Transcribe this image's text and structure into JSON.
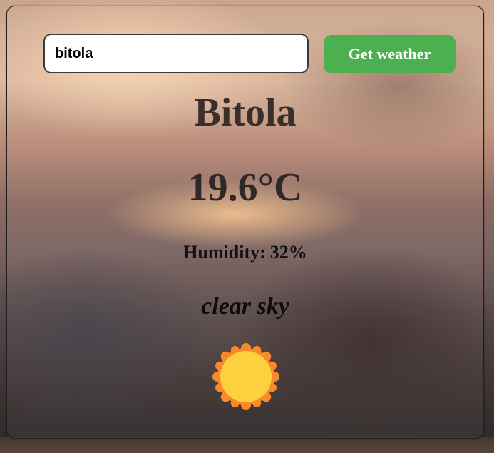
{
  "search": {
    "value": "bitola",
    "button_label": "Get weather"
  },
  "weather": {
    "city": "Bitola",
    "temperature": "19.6°C",
    "humidity_label": "Humidity:",
    "humidity_value": "32%",
    "description": "clear sky",
    "icon": "sun-icon"
  },
  "colors": {
    "button": "#4caf50",
    "sun_core": "#fdd13d",
    "sun_rays": "#f88a2a"
  }
}
